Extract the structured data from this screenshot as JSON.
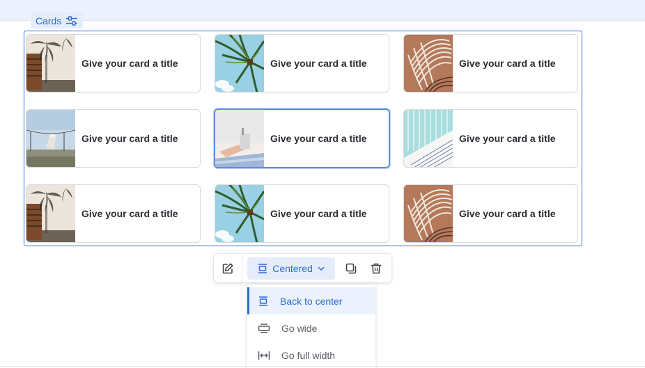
{
  "block": {
    "label": "Cards",
    "label_icon": "sliders-icon"
  },
  "cards": [
    {
      "title": "Give your card a title",
      "image": "palm-shadow-wall"
    },
    {
      "title": "Give your card a title",
      "image": "palm-sky"
    },
    {
      "title": "Give your card a title",
      "image": "wire-chair"
    },
    {
      "title": "Give your card a title",
      "image": "beach-hut"
    },
    {
      "title": "Give your card a title",
      "image": "pool-stairs"
    },
    {
      "title": "Give your card a title",
      "image": "glass-building"
    },
    {
      "title": "Give your card a title",
      "image": "palm-shadow-wall"
    },
    {
      "title": "Give your card a title",
      "image": "palm-sky"
    },
    {
      "title": "Give your card a title",
      "image": "wire-chair"
    }
  ],
  "toolbar": {
    "edit_icon": "pencil-icon",
    "align_label": "Centered",
    "align_icon": "align-center-icon",
    "duplicate_icon": "duplicate-icon",
    "delete_icon": "trash-icon"
  },
  "align_menu": {
    "items": [
      {
        "label": "Back to center",
        "icon": "align-center-icon",
        "active": true
      },
      {
        "label": "Go wide",
        "icon": "align-wide-icon",
        "active": false
      },
      {
        "label": "Go full width",
        "icon": "full-width-icon",
        "active": false
      }
    ]
  },
  "colors": {
    "accent": "#2d6bd0",
    "accent_bg": "#e5edfb",
    "card_border": "#d6d8dc",
    "title_text": "#2a2d33"
  }
}
